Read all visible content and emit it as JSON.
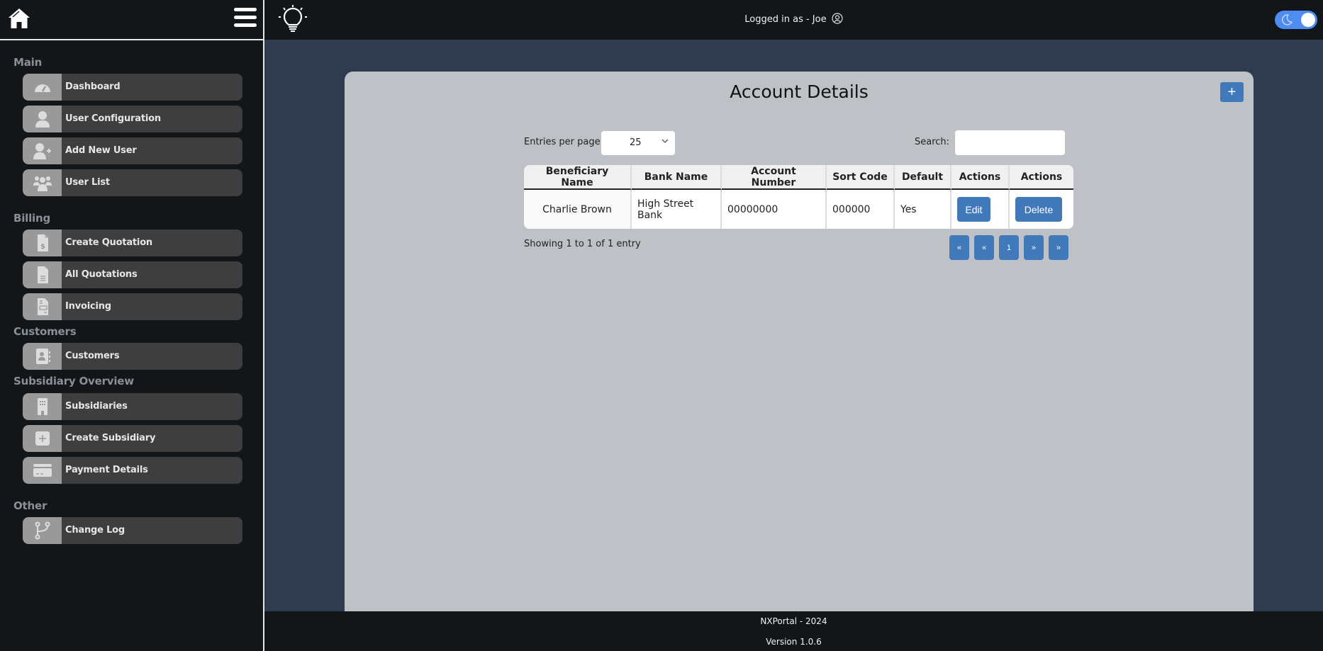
{
  "sidebar": {
    "sections": [
      {
        "title": "Main",
        "items": [
          {
            "label": "Dashboard",
            "icon": "gauge-icon"
          },
          {
            "label": "User Configuration",
            "icon": "user-icon"
          },
          {
            "label": "Add New User",
            "icon": "user-plus-icon"
          },
          {
            "label": "User List",
            "icon": "users-icon"
          }
        ]
      },
      {
        "title": "Billing",
        "items": [
          {
            "label": "Create Quotation",
            "icon": "file-dollar-icon"
          },
          {
            "label": "All Quotations",
            "icon": "file-lines-icon"
          },
          {
            "label": "Invoicing",
            "icon": "file-invoice-icon"
          }
        ]
      },
      {
        "title": "Customers",
        "items": [
          {
            "label": "Customers",
            "icon": "address-book-icon"
          }
        ]
      },
      {
        "title": "Subsidiary Overview",
        "items": [
          {
            "label": "Subsidiaries",
            "icon": "building-icon"
          },
          {
            "label": "Create Subsidiary",
            "icon": "square-plus-icon"
          },
          {
            "label": "Payment Details",
            "icon": "credit-card-icon"
          }
        ]
      },
      {
        "title": "Other",
        "items": [
          {
            "label": "Change Log",
            "icon": "code-branch-icon"
          }
        ]
      }
    ]
  },
  "topbar": {
    "logged_in_text": "Logged in as - Joe",
    "theme_toggle": "dark-mode-on"
  },
  "main": {
    "title": "Account Details",
    "add_button_label": "+",
    "entries_label": "Entries per page",
    "entries_value": "25",
    "search_label": "Search:",
    "search_value": "",
    "table": {
      "headers": [
        "Beneficiary Name",
        "Bank Name",
        "Account Number",
        "Sort Code",
        "Default",
        "Actions",
        "Actions"
      ],
      "rows": [
        {
          "beneficiary": "Charlie Brown",
          "bank": "High Street Bank",
          "account_number": "00000000",
          "sort_code": "000000",
          "default": "Yes",
          "edit_label": "Edit",
          "delete_label": "Delete"
        }
      ]
    },
    "showing_text": "Showing 1 to 1 of 1 entry",
    "pagination": [
      "«",
      "«",
      "1",
      "»",
      "»"
    ]
  },
  "footer": {
    "line1": "NXPortal - 2024",
    "line2": "Version 1.0.6"
  },
  "colors": {
    "sidebar_bg": "#131618",
    "page_bg": "#2f3c50",
    "card_bg": "#bec2c6",
    "accent_blue": "#4279bb",
    "toggle_blue": "#4e8cf0"
  }
}
